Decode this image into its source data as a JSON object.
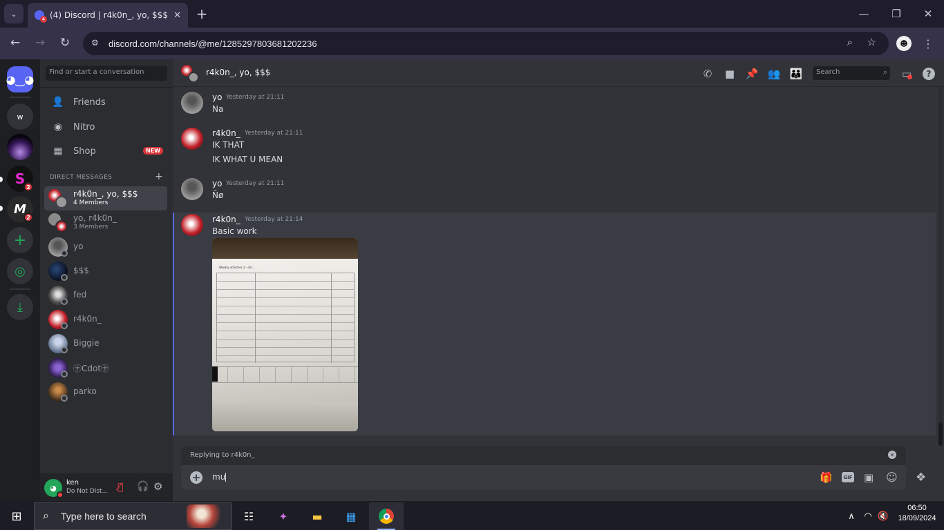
{
  "browser": {
    "tab_title": "(4) Discord | r4k0n_, yo, $$$",
    "tab_badge": "4",
    "url": "discord.com/channels/@me/1285297803681202236"
  },
  "guilds": {
    "items": [
      {
        "label": "w"
      },
      {
        "badge": "2"
      },
      {
        "badge": "2"
      }
    ]
  },
  "sidebar": {
    "search_placeholder": "Find or start a conversation",
    "nav": [
      {
        "label": "Friends"
      },
      {
        "label": "Nitro"
      },
      {
        "label": "Shop",
        "badge": "NEW"
      }
    ],
    "dm_header": "DIRECT MESSAGES",
    "dms": [
      {
        "name": "r4k0n_, yo, $$$",
        "sub": "4 Members"
      },
      {
        "name": "yo, r4k0n_",
        "sub": "3 Members"
      },
      {
        "name": "yo"
      },
      {
        "name": "$$$"
      },
      {
        "name": "fed"
      },
      {
        "name": "r4k0n_"
      },
      {
        "name": "Biggie"
      },
      {
        "name": "㊉Cdot㊉"
      },
      {
        "name": "parko"
      }
    ]
  },
  "user": {
    "name": "ken",
    "status": "Do Not Dist..."
  },
  "channel": {
    "title": "r4k0n_, yo, $$$",
    "search_placeholder": "Search"
  },
  "messages": [
    {
      "author": "yo",
      "time": "Yesterday at 21:11",
      "lines": [
        "Na"
      ]
    },
    {
      "author": "r4k0n_",
      "time": "Yesterday at 21:11",
      "lines": [
        "IK THAT",
        "IK WHAT U MEAN"
      ]
    },
    {
      "author": "yo",
      "time": "Yesterday at 21:11",
      "lines": [
        "Ñø"
      ]
    },
    {
      "author": "r4k0n_",
      "time": "Yesterday at 21:14",
      "lines": [
        "Basic work"
      ]
    }
  ],
  "attachment": {
    "heading": "Weekly activities 2  -  dsc..."
  },
  "composer": {
    "replying_to": "Replying to r4k0n_",
    "value": "mu"
  },
  "taskbar": {
    "search_placeholder": "Type here to search",
    "time": "06:50",
    "date": "18/09/2024"
  }
}
